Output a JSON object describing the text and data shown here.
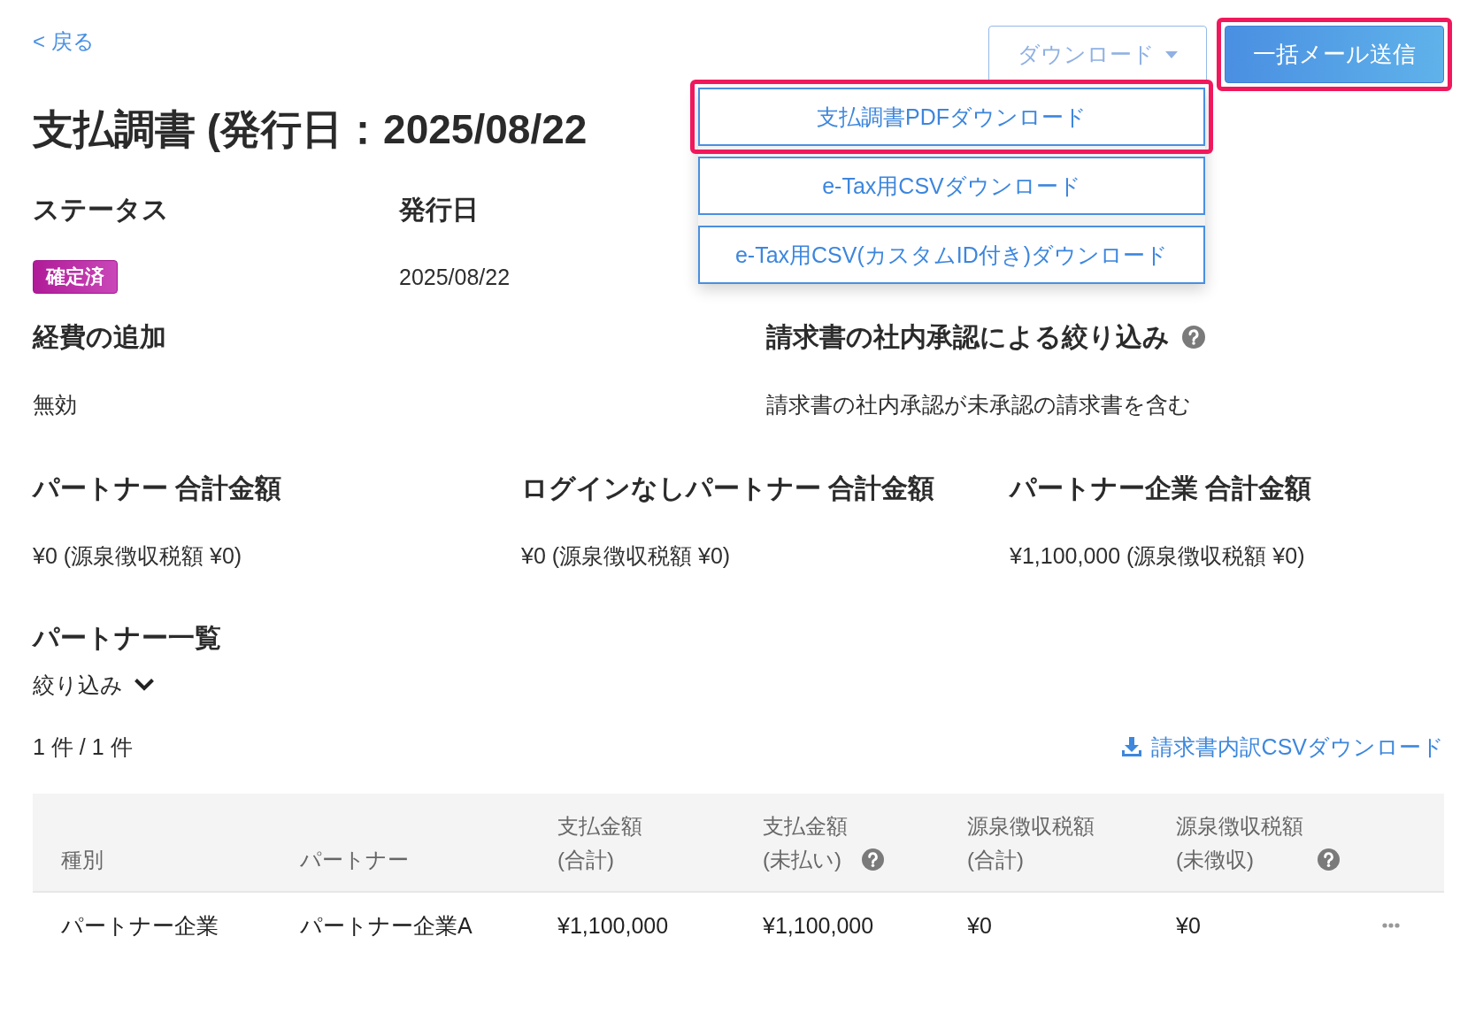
{
  "back_link": {
    "label": "< 戻る"
  },
  "actions": [
    {
      "kind": "dropdown",
      "label": "ダウンロード",
      "expanded": true,
      "highlighted": false
    },
    {
      "kind": "primary",
      "label": "一括メール送信",
      "highlighted": true
    }
  ],
  "download_menu": [
    {
      "label": "支払調書PDFダウンロード",
      "highlighted": true
    },
    {
      "label": "e-Tax用CSVダウンロード",
      "highlighted": false
    },
    {
      "label": "e-Tax用CSV(カスタムID付き)ダウンロード",
      "highlighted": false
    }
  ],
  "title": "支払調書 (発行日：2025/08/22",
  "detail_rows": [
    [
      {
        "label": "ステータス",
        "kind": "badge",
        "value": "確定済",
        "help": false
      },
      {
        "label": "発行日",
        "kind": "text",
        "value": "2025/08/22",
        "help": false
      }
    ],
    [
      {
        "label": "経費の追加",
        "kind": "text",
        "value": "無効",
        "help": false
      },
      {
        "label": "請求書の社内承認による絞り込み",
        "kind": "text",
        "value": "請求書の社内承認が未承認の請求書を含む",
        "help": true
      }
    ],
    [
      {
        "label": "パートナー 合計金額",
        "kind": "text",
        "value": "¥0 (源泉徴収税額 ¥0)",
        "help": false
      },
      {
        "label": "ログインなしパートナー 合計金額",
        "kind": "text",
        "value": "¥0 (源泉徴収税額 ¥0)",
        "help": false
      },
      {
        "label": "パートナー企業 合計金額",
        "kind": "text",
        "value": "¥1,100,000 (源泉徴収税額 ¥0)",
        "help": false
      }
    ]
  ],
  "partner_list": {
    "title": "パートナー一覧",
    "filter": {
      "label": "絞り込み",
      "expanded": false
    },
    "count": "1 件 / 1 件",
    "csv_link": "請求書内訳CSVダウンロード",
    "table": {
      "columns": [
        {
          "label": "種別",
          "help": false
        },
        {
          "label": "パートナー",
          "help": false
        },
        {
          "label": "支払金額",
          "sublabel": "(合計)",
          "help": false
        },
        {
          "label": "支払金額",
          "sublabel": "(未払い)",
          "help": true
        },
        {
          "label": "源泉徴収税額",
          "sublabel": "(合計)",
          "help": false
        },
        {
          "label": "源泉徴収税額",
          "sublabel": "(未徴収)",
          "help": true
        }
      ],
      "rows": [
        {
          "cells": [
            "パートナー企業",
            "パートナー企業A",
            "¥1,100,000",
            "¥1,100,000",
            "¥0",
            "¥0"
          ]
        }
      ]
    }
  }
}
